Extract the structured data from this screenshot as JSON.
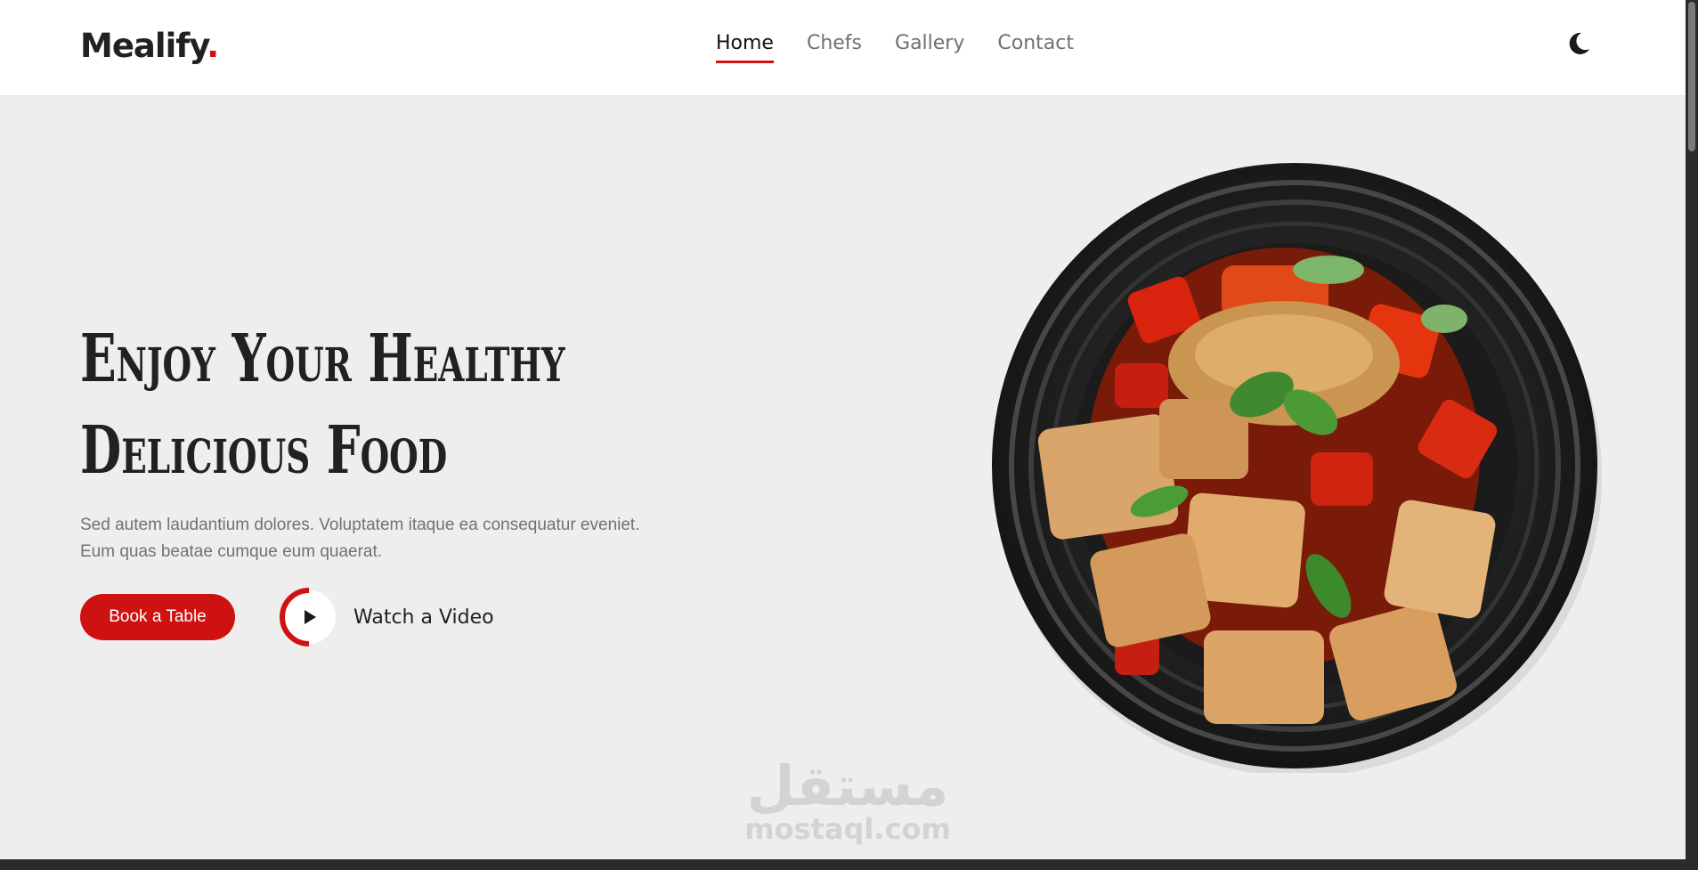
{
  "brand": {
    "name": "Mealify",
    "dot": "."
  },
  "nav": {
    "items": [
      {
        "label": "Home",
        "active": true
      },
      {
        "label": "Chefs",
        "active": false
      },
      {
        "label": "Gallery",
        "active": false
      },
      {
        "label": "Contact",
        "active": false
      }
    ],
    "theme_icon": "moon-icon"
  },
  "hero": {
    "title_line1": "Enjoy Your Healthy",
    "title_line2": "Delicious Food",
    "description_line1": "Sed autem laudantium dolores. Voluptatem itaque ea consequatur eveniet.",
    "description_line2": "Eum quas beatae cumque eum quaerat.",
    "book_label": "Book a Table",
    "video_label": "Watch a Video",
    "image": "plate of tofu with peppers"
  },
  "watermark": {
    "arabic": "مستقل",
    "latin": "mostaql.com"
  },
  "colors": {
    "accent": "#ce1212",
    "background": "#eeeeee",
    "header": "#ffffff",
    "text": "#212121",
    "muted": "#6d7378"
  }
}
